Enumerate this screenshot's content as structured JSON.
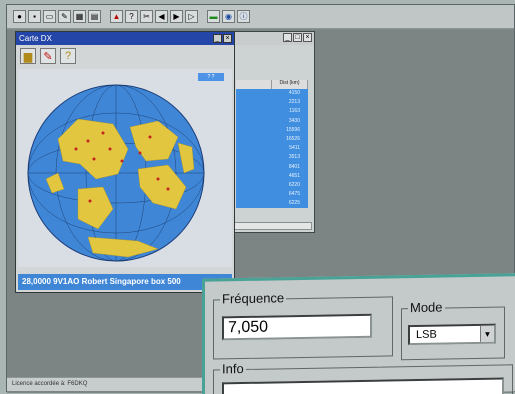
{
  "toolbar": {
    "icons": [
      "globe-icon",
      "save-icon",
      "print-icon",
      "tool-icon",
      "grid-icon",
      "folder-icon",
      "alert-icon",
      "help-icon",
      "cut-icon",
      "prev-icon",
      "next-icon",
      "end-icon",
      "chart-icon",
      "info-icon",
      "about-icon"
    ]
  },
  "carte_window": {
    "title": "Carte DX",
    "tools": [
      "open-folder",
      "pencil",
      "help-question"
    ],
    "map_button": "? ?",
    "footer": "28,0000 9V1AO Robert Singapore  box 500"
  },
  "table_window": {
    "headers": [
      "",
      "Dist (km)"
    ],
    "rows": [
      "4150",
      "2213",
      "1163",
      "3430",
      "15596",
      "16526",
      "5411",
      "3513",
      "8401",
      "4651",
      "6220",
      "6475",
      "6225"
    ]
  },
  "status_bar": {
    "text": "Licence accordée à: F6DKQ"
  },
  "freq_panel": {
    "frequency_label": "Fréquence",
    "frequency_value": "7,050",
    "mode_label": "Mode",
    "mode_value": "LSB",
    "info_label": "Info"
  },
  "colors": {
    "map_ocean": "#3f86d6",
    "selection": "#3f8ee0",
    "panel_border": "#49a296"
  }
}
